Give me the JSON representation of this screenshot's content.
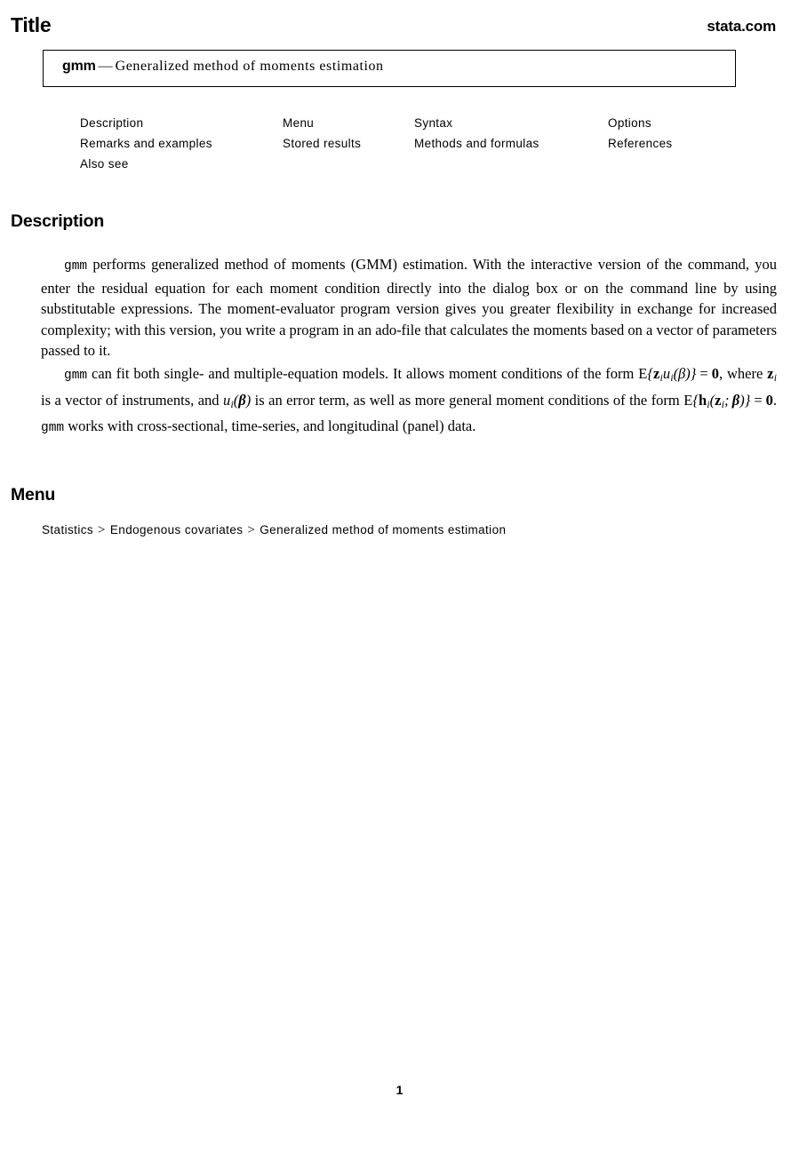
{
  "header": {
    "title_label": "Title",
    "site_label": "stata.com"
  },
  "title_box": {
    "command": "gmm",
    "dash": "—",
    "description": "Generalized method of moments estimation"
  },
  "nav_links": {
    "rows": [
      [
        {
          "label": "Description"
        },
        {
          "label": "Menu"
        },
        {
          "label": "Syntax"
        },
        {
          "label": "Options"
        }
      ],
      [
        {
          "label": "Remarks and examples"
        },
        {
          "label": "Stored results"
        },
        {
          "label": "Methods and formulas"
        },
        {
          "label": "References"
        }
      ],
      [
        {
          "label": "Also see"
        },
        {
          "label": ""
        },
        {
          "label": ""
        },
        {
          "label": ""
        }
      ]
    ]
  },
  "sections": {
    "description": {
      "heading": "Description",
      "paragraph_1": {
        "cmd": "gmm",
        "text": " performs generalized method of moments (GMM) estimation. With the interactive version of the command, you enter the residual equation for each moment condition directly into the dialog box or on the command line by using substitutable expressions. The moment-evaluator program version gives you greater flexibility in exchange for increased complexity; with this version, you write a program in an ado-file that calculates the moments based on a vector of parameters passed to it."
      },
      "paragraph_2": {
        "cmd_1": "gmm",
        "text_1": " can fit both single- and multiple-equation models. It allows moment conditions of the form ",
        "formula_1": "E{z_i u_i(β)} = 0",
        "text_2": ", where ",
        "formula_2": "z_i",
        "text_3": " is a vector of instruments, and ",
        "formula_3": "u_i(β)",
        "text_4": " is an error term, as well as more general moment conditions of the form ",
        "formula_4": "E{h_i(z_i; β)} = 0",
        "text_5": ". ",
        "cmd_2": "gmm",
        "text_6": " works with cross-sectional, time-series, and longitudinal (panel) data."
      }
    },
    "menu": {
      "heading": "Menu",
      "breadcrumb": {
        "items": [
          "Statistics",
          "Endogenous covariates",
          "Generalized method of moments estimation"
        ],
        "separator": ">"
      }
    }
  },
  "footer": {
    "page_number": "1"
  }
}
